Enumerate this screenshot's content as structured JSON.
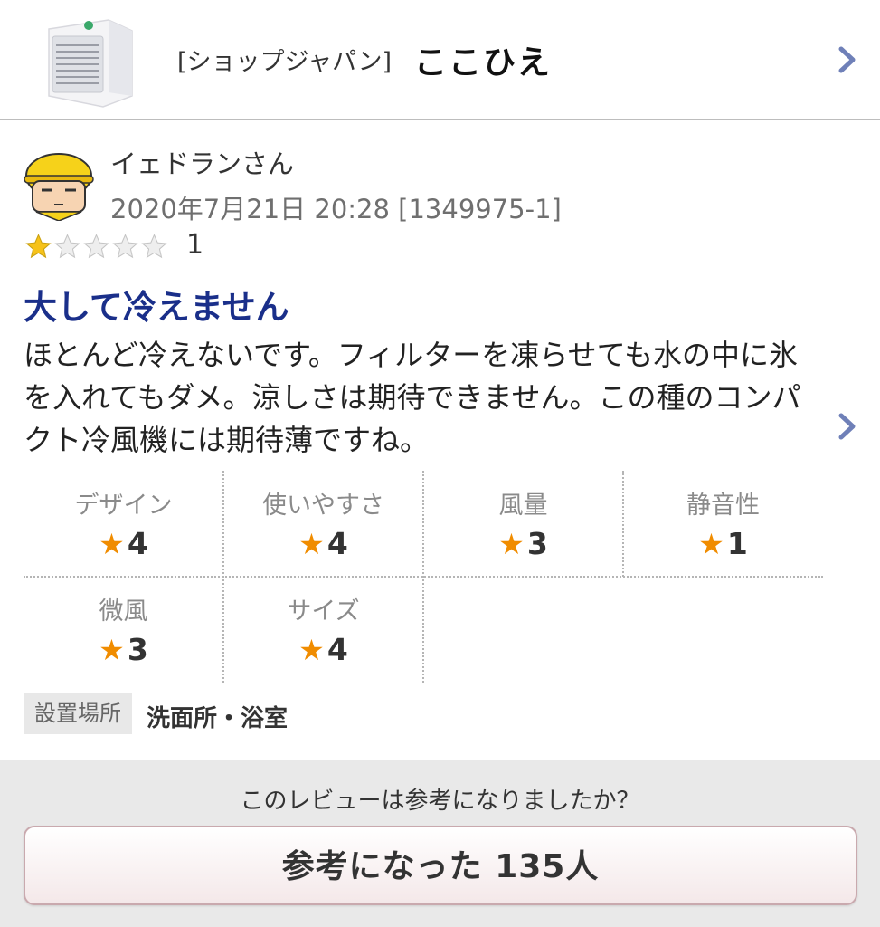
{
  "product": {
    "shop": "[ショップジャパン]",
    "name": "ここひえ"
  },
  "review": {
    "user_name": "イェドランさん",
    "meta": "2020年7月21日 20:28 [1349975-1]",
    "rating": 1,
    "rating_max": 5,
    "rating_text": "1",
    "title": "大して冷えません",
    "body": "ほとんど冷えないです。フィルターを凍らせても水の中に氷を入れてもダメ。涼しさは期待できません。この種のコンパクト冷風機には期待薄ですね。",
    "sub_ratings": [
      {
        "label": "デザイン",
        "value": "4"
      },
      {
        "label": "使いやすさ",
        "value": "4"
      },
      {
        "label": "風量",
        "value": "3"
      },
      {
        "label": "静音性",
        "value": "1"
      },
      {
        "label": "微風",
        "value": "3"
      },
      {
        "label": "サイズ",
        "value": "4"
      }
    ],
    "star_glyph": "★",
    "place_label": "設置場所",
    "place_value": "洗面所・浴室"
  },
  "feedback": {
    "question": "このレビューは参考になりましたか？",
    "button_label": "参考になった 135人"
  },
  "colors": {
    "title_blue": "#1a2f8a",
    "star_orange": "#f08c00",
    "chevron": "#6f80b8"
  }
}
